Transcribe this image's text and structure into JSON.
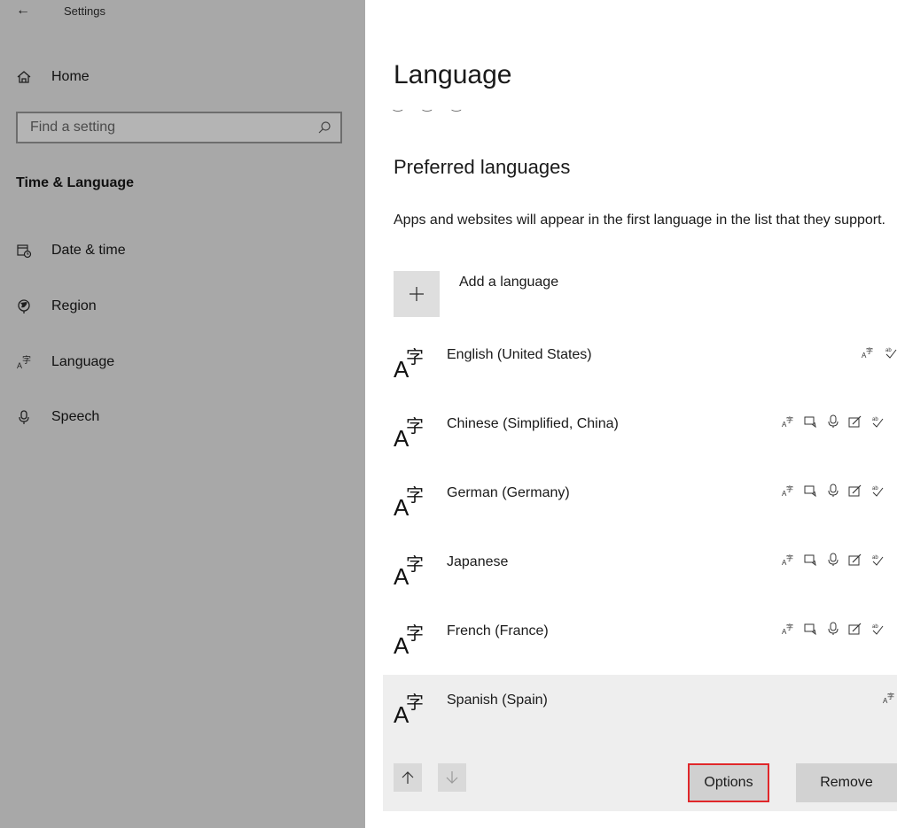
{
  "app": {
    "title": "Settings"
  },
  "sidebar": {
    "home_label": "Home",
    "search_placeholder": "Find a setting",
    "section_title": "Time & Language",
    "items": [
      {
        "label": "Date & time",
        "icon": "calendar-clock-icon"
      },
      {
        "label": "Region",
        "icon": "globe-icon"
      },
      {
        "label": "Language",
        "icon": "language-icon"
      },
      {
        "label": "Speech",
        "icon": "microphone-icon"
      }
    ]
  },
  "main": {
    "title": "Language",
    "subtitle": "Preferred languages",
    "description": "Apps and websites will appear in the first language in the list that they support.",
    "add_label": "Add a language",
    "languages": [
      {
        "name": "English (United States)",
        "features": [
          "display-language-icon",
          "spelling-icon"
        ]
      },
      {
        "name": "Chinese (Simplified, China)",
        "features": [
          "display-language-icon",
          "text-to-speech-icon",
          "speech-icon",
          "handwriting-icon",
          "spelling-icon"
        ]
      },
      {
        "name": "German (Germany)",
        "features": [
          "display-language-icon",
          "text-to-speech-icon",
          "speech-icon",
          "handwriting-icon",
          "spelling-icon"
        ]
      },
      {
        "name": "Japanese",
        "features": [
          "display-language-icon",
          "text-to-speech-icon",
          "speech-icon",
          "handwriting-icon",
          "spelling-icon"
        ]
      },
      {
        "name": "French (France)",
        "features": [
          "display-language-icon",
          "text-to-speech-icon",
          "speech-icon",
          "handwriting-icon",
          "spelling-icon"
        ]
      },
      {
        "name": "Spanish (Spain)",
        "features": [
          "display-language-icon"
        ],
        "selected": true
      }
    ],
    "buttons": {
      "options": "Options",
      "remove": "Remove"
    }
  },
  "colors": {
    "sidebar_bg": "#a8a8a8",
    "highlight_border": "#e0272a",
    "selected_bg": "#eeeeee"
  }
}
